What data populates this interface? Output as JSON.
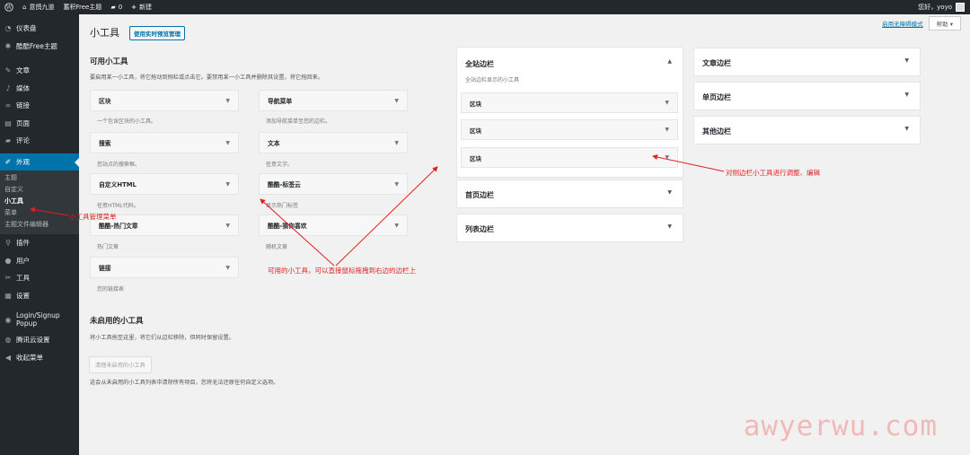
{
  "adminbar": {
    "wp_logo": "wordpress-icon",
    "site_name": "意鸽九道",
    "theme_link": "蓄积Free主题",
    "comments_count": "0",
    "new_label": "新建",
    "greeting": "您好，yoyo"
  },
  "sidebar": {
    "items": [
      {
        "label": "仪表盘",
        "icon": "dashboard-icon"
      },
      {
        "label": "酷酷Free主题",
        "icon": "gear-icon"
      },
      {
        "label": "文章",
        "icon": "pin-icon"
      },
      {
        "label": "媒体",
        "icon": "media-icon"
      },
      {
        "label": "链接",
        "icon": "link-icon"
      },
      {
        "label": "页面",
        "icon": "page-icon"
      },
      {
        "label": "评论",
        "icon": "comment-icon"
      },
      {
        "label": "外观",
        "icon": "brush-icon"
      }
    ],
    "submenu": [
      "主题",
      "自定义",
      "小工具",
      "菜单",
      "主题文件编辑器"
    ],
    "items_after": [
      {
        "label": "插件",
        "icon": "plugin-icon"
      },
      {
        "label": "用户",
        "icon": "user-icon"
      },
      {
        "label": "工具",
        "icon": "wrench-icon"
      },
      {
        "label": "设置",
        "icon": "settings-icon"
      },
      {
        "label": "Login/Signup Popup",
        "icon": "login-icon"
      },
      {
        "label": "腾讯云设置",
        "icon": "cloud-icon"
      },
      {
        "label": "收起菜单",
        "icon": "collapse-icon"
      }
    ]
  },
  "header": {
    "title": "小工具",
    "preview_button": "使用实时预览管理",
    "accessibility_link": "启用无障碍模式",
    "help_button": "帮助 ▾"
  },
  "available": {
    "heading": "可用小工具",
    "description": "要启用某一小工具，将它拖动到侧栏或点击它。要禁用某一小工具并删除其设置，将它拖回来。",
    "widgets": [
      {
        "name": "区块",
        "desc": "一个包含区块的小工具。"
      },
      {
        "name": "导航菜单",
        "desc": "添加导航菜单至您的边栏。"
      },
      {
        "name": "搜索",
        "desc": "您站点的搜索框。"
      },
      {
        "name": "文本",
        "desc": "任意文字。"
      },
      {
        "name": "自定义HTML",
        "desc": "任意HTML代码。"
      },
      {
        "name": "酷酷-标签云",
        "desc": "显示热门标签"
      },
      {
        "name": "酷酷-热门文章",
        "desc": "热门文章"
      },
      {
        "name": "酷酷-猜你喜欢",
        "desc": "随机文章"
      },
      {
        "name": "链接",
        "desc": "您的链接表"
      }
    ]
  },
  "inactive": {
    "heading": "未启用的小工具",
    "description": "将小工具拖至这里，将它们从边栏移除，但同时保留设置。",
    "clear_button": "清理未启用的小工具",
    "note": "这会从未启用的小工具列表中清除所有项目，您将无法还原任何自定义选项。"
  },
  "sidebars_col1": {
    "main": {
      "title": "全站边栏",
      "desc": "全站边栏显示的小工具",
      "widgets": [
        "区块",
        "区块",
        "区块"
      ]
    },
    "others": [
      "首页边栏",
      "列表边栏"
    ]
  },
  "sidebars_col2": [
    "文章边栏",
    "单页边栏",
    "其他边栏"
  ],
  "annotations": {
    "menu_note": "小工具管理菜单",
    "drag_note": "可用的小工具，可以直接鼠标拖拽到右边的边栏上",
    "edit_note": "对侧边栏小工具进行调整、编辑"
  },
  "watermark": "awyerwu.com",
  "colors": {
    "admin_dark": "#23282d",
    "accent": "#0073aa",
    "annotation": "#e02020"
  }
}
